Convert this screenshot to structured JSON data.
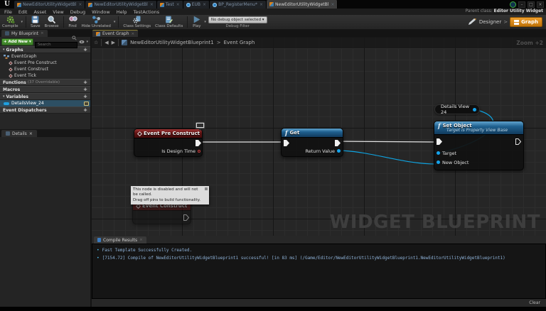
{
  "glyphs": {
    "caret": "▾",
    "close": "×",
    "star": "☆",
    "back": "◀",
    "forward": "▶",
    "plus": "+",
    "chevron": ">",
    "minimize": "–",
    "maximize": "□",
    "window_close": "×",
    "bullet": "•",
    "expander": "▾",
    "logo": "U"
  },
  "titlebar": {
    "tabs": [
      {
        "label": "NewEditorUtilityWidgetBl"
      },
      {
        "label": "NewEditorUtilityWidgetBl"
      },
      {
        "label": "Test"
      },
      {
        "label": "EUB"
      },
      {
        "label": "BP_RegisterMenu*"
      },
      {
        "label": "NewEditorUtilityWidgetBl"
      }
    ]
  },
  "menubar": {
    "items": [
      "File",
      "Edit",
      "Asset",
      "View",
      "Debug",
      "Window",
      "Help",
      "TestActions"
    ],
    "parent_label": "Parent class:",
    "parent_value": "Editor Utility Widget"
  },
  "toolbar": {
    "compile": "Compile",
    "save": "Save",
    "browse": "Browse",
    "find": "Find",
    "hide_unrelated": "Hide Unrelated",
    "class_settings": "Class Settings",
    "class_defaults": "Class Defaults",
    "play": "Play",
    "debug_value": "No debug object selected ▾",
    "debug_caption": "Debug Filter",
    "designer": "Designer",
    "graph": "Graph"
  },
  "dock": {
    "my_blueprint": "My Blueprint",
    "event_graph": "Event Graph"
  },
  "my_blueprint": {
    "add_new": "+ Add New",
    "search_placeholder": "Search",
    "graphs_header": "Graphs",
    "event_graph": "EventGraph",
    "events": [
      "Event Pre Construct",
      "Event Construct",
      "Event Tick"
    ],
    "functions_header": "Functions",
    "functions_note": "(37 Overridable)",
    "macros_header": "Macros",
    "variables_header": "Variables",
    "variable_name": "DetailsView_24",
    "dispatchers_header": "Event Dispatchers",
    "details_tab": "Details"
  },
  "graph": {
    "breadcrumb_root": "NewEditorUtilityWidgetBlueprint1",
    "breadcrumb_sep": ">",
    "breadcrumb_current": "Event Graph",
    "zoom": "Zoom +2",
    "watermark": "WIDGET BLUEPRINT",
    "nodes": {
      "pre_construct": {
        "title": "Event Pre Construct",
        "out_pin": "Is Design Time"
      },
      "get": {
        "title": "Get",
        "out_pin": "Return Value"
      },
      "set_object": {
        "title": "Set Object",
        "subtitle": "Target is Property View Base",
        "target_pin": "Target",
        "new_object_pin": "New Object"
      },
      "details_view": {
        "title": "Details View 24"
      },
      "construct": {
        "title": "Event Construct",
        "tooltip_line1": "This node is disabled and will not be called.",
        "tooltip_line2": "Drag off pins to build functionality."
      }
    },
    "colors": {
      "exec_wire": "#e4e4e4",
      "data_wire": "#0fa3e0"
    }
  },
  "compile_results": {
    "tab": "Compile Results",
    "lines": [
      "Fast Template Successfully Created.",
      "[7154.72] Compile of NewEditorUtilityWidgetBlueprint1 successful! [in 83 ms] (/Game/Editor/NewEditorUtilityWidgetBlueprint1.NewEditorUtilityWidgetBlueprint1)"
    ],
    "clear": "Clear"
  }
}
